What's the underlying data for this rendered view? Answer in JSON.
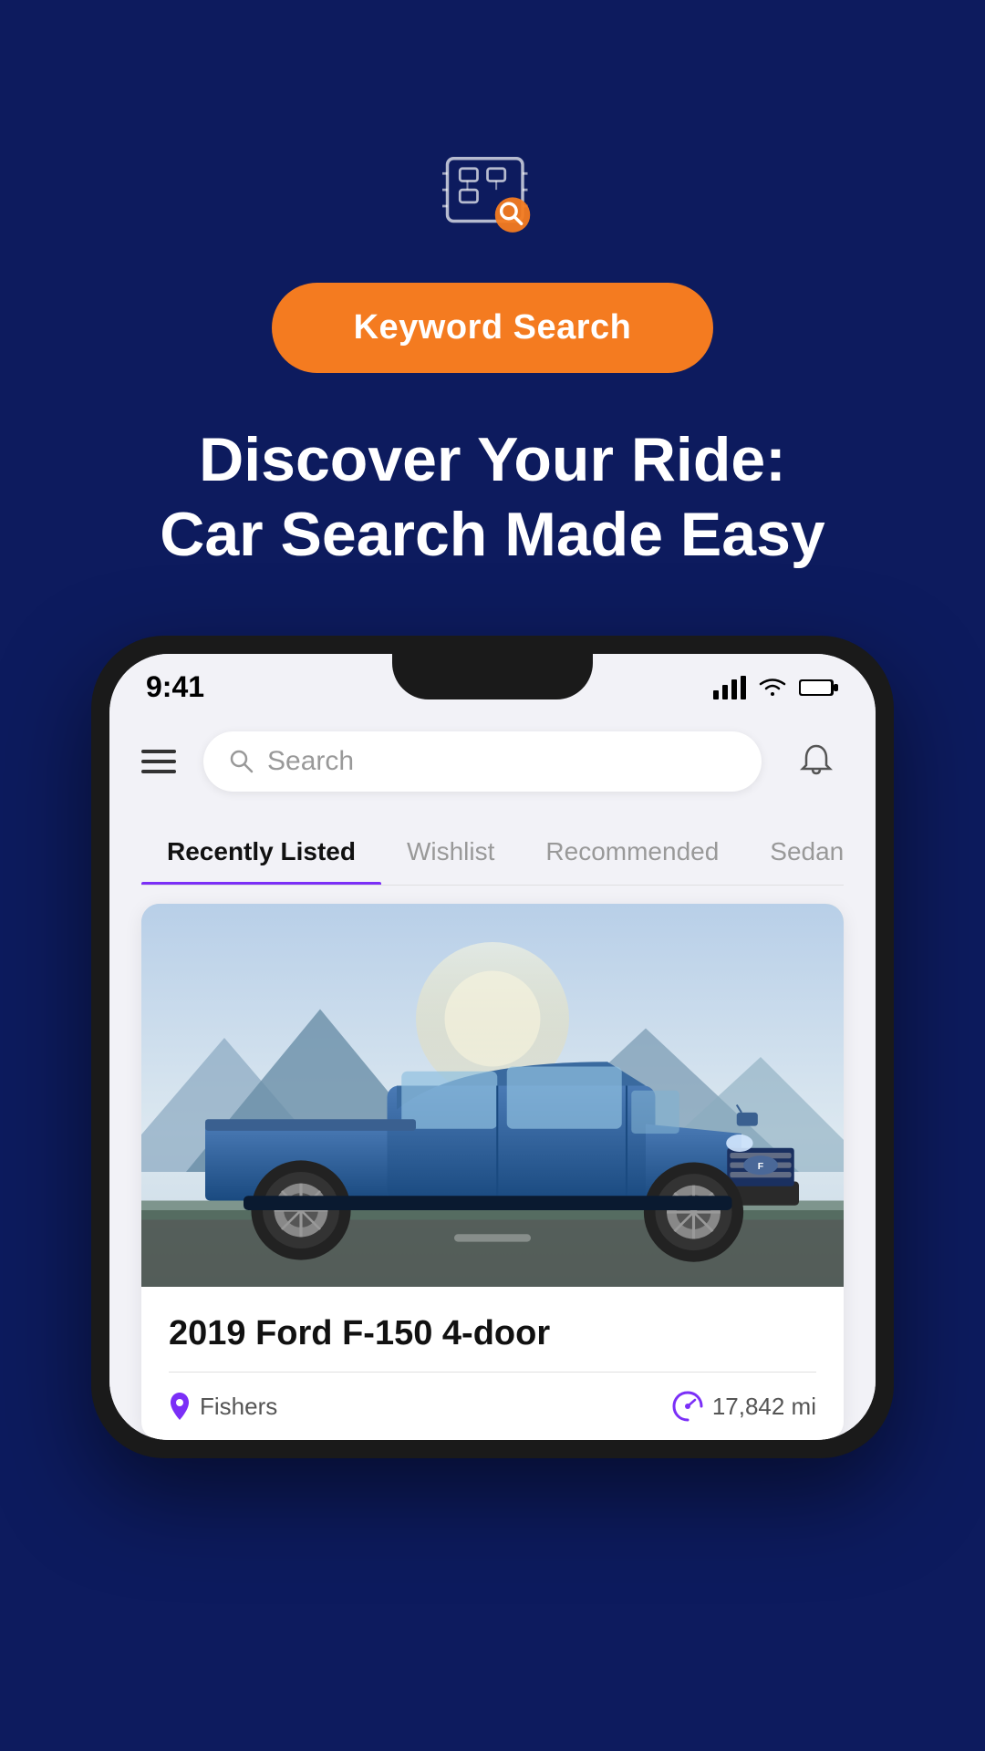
{
  "app": {
    "background_color": "#0d1b5e"
  },
  "hero": {
    "keyword_btn_label": "Keyword Search",
    "headline_line1": "Discover Your Ride:",
    "headline_line2": "Car Search Made Easy"
  },
  "phone": {
    "status_bar": {
      "time": "9:41"
    },
    "search": {
      "placeholder": "Search"
    },
    "tabs": [
      {
        "label": "Recently Listed",
        "active": true
      },
      {
        "label": "Wishlist",
        "active": false
      },
      {
        "label": "Recommended",
        "active": false
      },
      {
        "label": "Sedans",
        "active": false
      }
    ],
    "car_listing": {
      "title": "2019 Ford F-150 4-door",
      "location": "Fishers",
      "mileage": "17,842 mi"
    }
  }
}
